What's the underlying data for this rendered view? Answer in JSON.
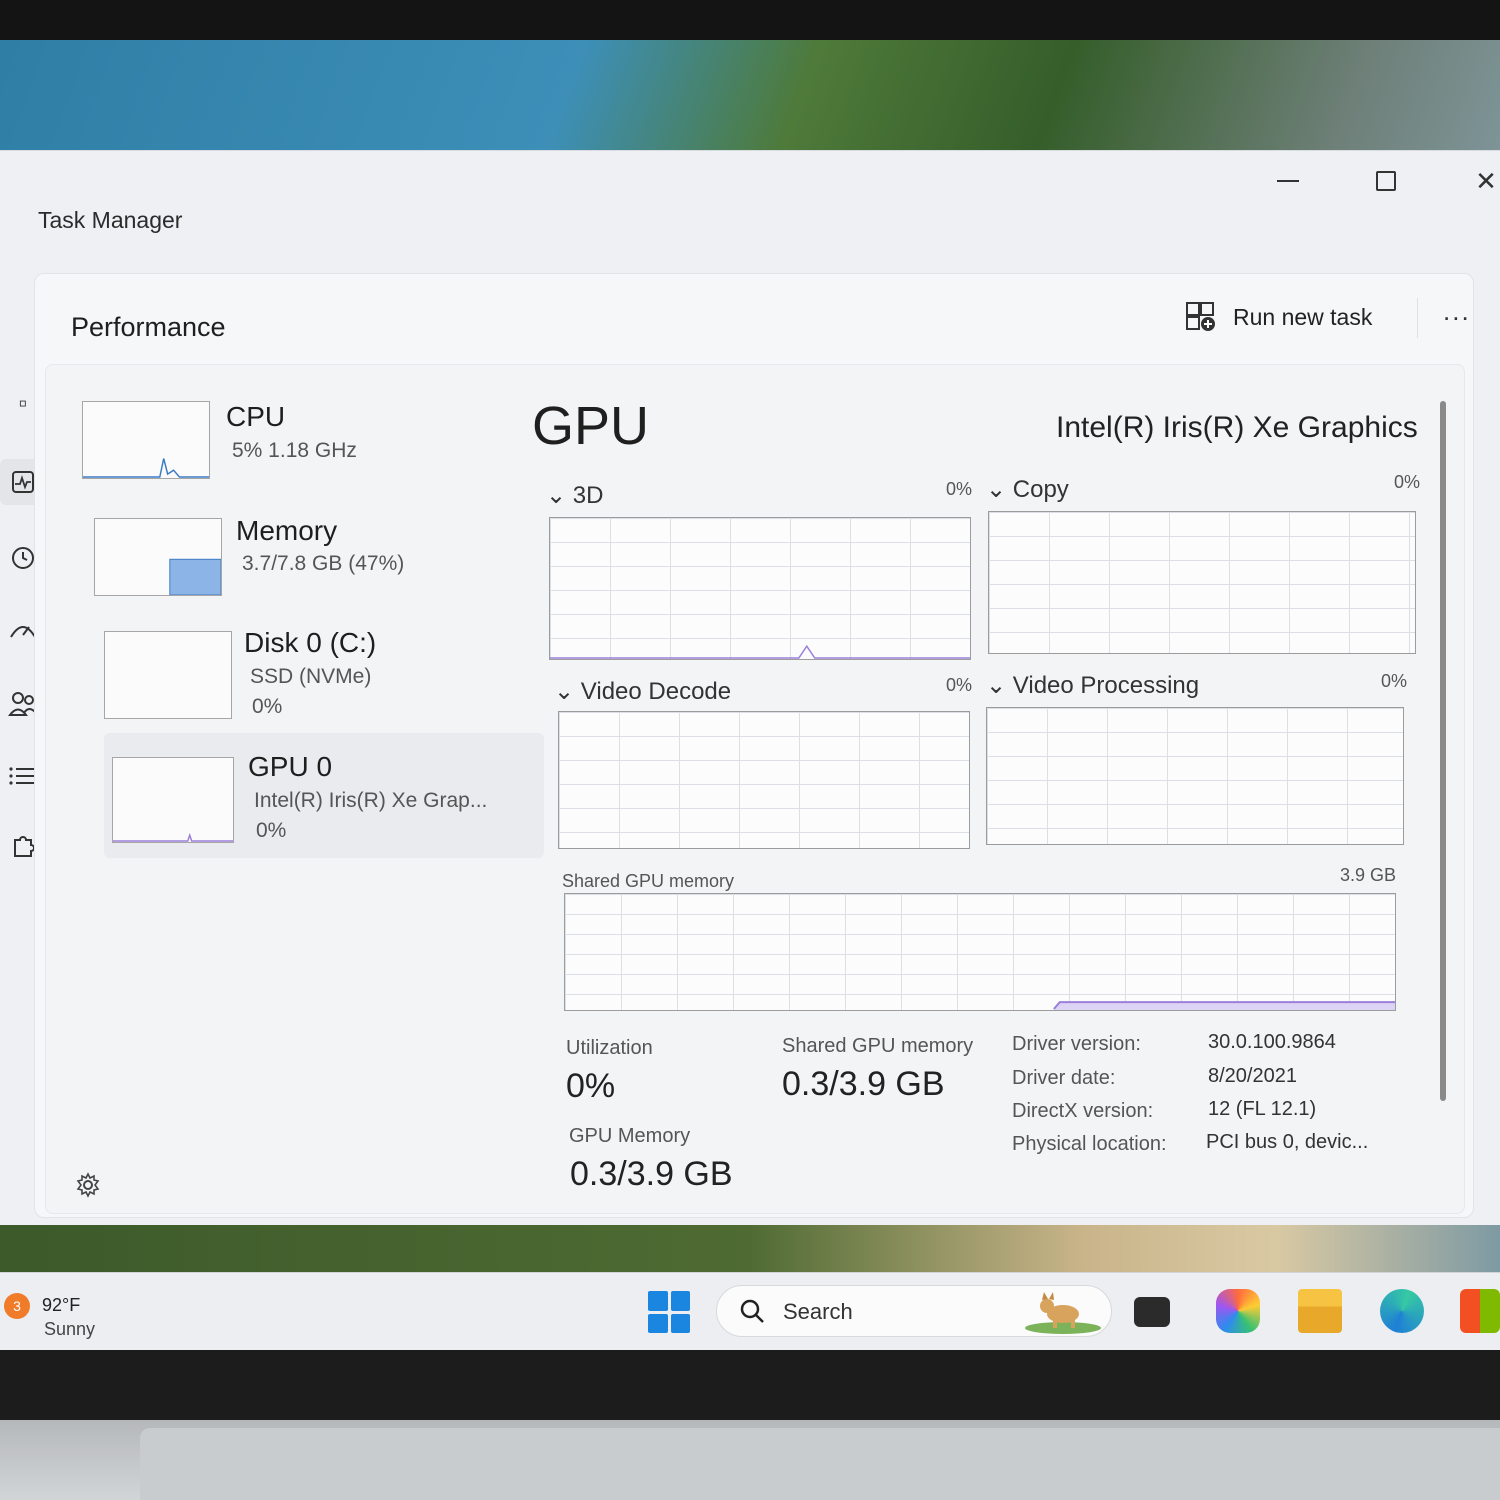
{
  "window": {
    "title": "Task Manager",
    "page_title": "Performance",
    "run_new_task": "Run new task",
    "more": "..."
  },
  "devices": [
    {
      "name": "CPU",
      "line1": "5%  1.18 GHz",
      "line2": "",
      "usage": 0.05
    },
    {
      "name": "Memory",
      "line1": "3.7/7.8 GB (47%)",
      "line2": "",
      "usage": 0.47
    },
    {
      "name": "Disk 0 (C:)",
      "line1": "SSD (NVMe)",
      "line2": "0%",
      "usage": 0
    },
    {
      "name": "GPU 0",
      "line1": "Intel(R) Iris(R) Xe Grap...",
      "line2": "0%",
      "usage": 0
    }
  ],
  "gpu": {
    "title": "GPU",
    "model": "Intel(R) Iris(R) Xe Graphics",
    "engines": [
      {
        "label": "3D",
        "value": "0%"
      },
      {
        "label": "Copy",
        "value": "0%"
      },
      {
        "label": "Video Decode",
        "value": "0%"
      },
      {
        "label": "Video Processing",
        "value": "0%"
      }
    ],
    "shared_memory_graph": {
      "label": "Shared GPU memory",
      "max": "3.9 GB"
    },
    "stats": {
      "utilization_label": "Utilization",
      "utilization_value": "0%",
      "shared_label": "Shared GPU memory",
      "shared_value": "0.3/3.9 GB",
      "gpu_memory_label": "GPU Memory",
      "gpu_memory_value": "0.3/3.9 GB"
    },
    "details": [
      {
        "key": "Driver version:",
        "value": "30.0.100.9864"
      },
      {
        "key": "Driver date:",
        "value": "8/20/2021"
      },
      {
        "key": "DirectX version:",
        "value": "12 (FL 12.1)"
      },
      {
        "key": "Physical location:",
        "value": "PCI bus 0, devic..."
      }
    ]
  },
  "taskbar": {
    "weather_badge": "3",
    "temperature": "92°F",
    "condition": "Sunny",
    "search_placeholder": "Search"
  },
  "colors": {
    "memory_fill": "#8db4e6",
    "gpu_line": "#9b7fd9",
    "accent": "#1a86e0"
  }
}
